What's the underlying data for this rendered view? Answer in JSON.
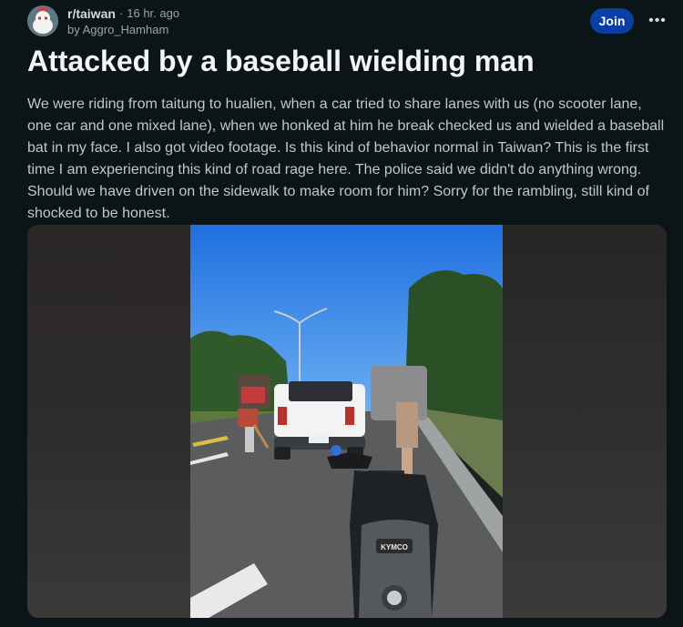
{
  "post": {
    "subreddit": "r/taiwan",
    "separator": "·",
    "time_ago": "16 hr. ago",
    "author": "by Aggro_Hamham",
    "join_label": "Join",
    "more_label": "•••",
    "title": "Attacked by a baseball wielding man",
    "body": "We were riding from taitung to hualien, when a car tried to share lanes with us (no scooter lane, one car and one mixed lane), when we honked at him he break checked us and wielded a baseball bat in my face. I also got video footage. Is this kind of behavior normal in Taiwan? This is the first time I am experiencing this kind of road rage here. The police said we didn't do anything wrong. Should we have driven on the sidewalk to make room for him? Sorry for the rambling, still kind of shocked to be honest."
  },
  "media": {
    "scooter_brand": "KYMCO"
  },
  "colors": {
    "background": "#0b1416",
    "join_button": "#0a3fa6",
    "sky": "#2f7fe0"
  }
}
